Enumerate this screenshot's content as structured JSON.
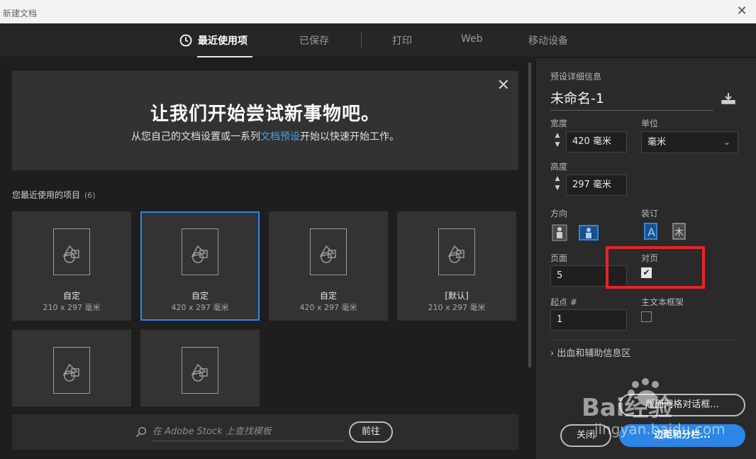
{
  "window": {
    "title": "新建文档"
  },
  "tabs": [
    {
      "label": "最近使用项",
      "active": true
    },
    {
      "label": "已保存"
    },
    {
      "label": "打印"
    },
    {
      "label": "Web"
    },
    {
      "label": "移动设备"
    }
  ],
  "welcome": {
    "heading": "让我们开始尝试新事物吧。",
    "text_before": "从您自己的文档设置或一系列",
    "link": "文档预设",
    "text_after": "开始以快速开始工作。"
  },
  "recent": {
    "label": "您最近使用的项目",
    "count": "(6)",
    "items": [
      {
        "name": "自定",
        "size": "210 x 297 毫米"
      },
      {
        "name": "自定",
        "size": "420 x 297 毫米",
        "selected": true
      },
      {
        "name": "自定",
        "size": "420 x 297 毫米"
      },
      {
        "name": "[默认]",
        "size": "210 x 297 毫米"
      },
      {
        "name": "",
        "size": ""
      },
      {
        "name": "",
        "size": ""
      }
    ]
  },
  "search": {
    "placeholder": "在 Adobe Stock 上查找模板",
    "go_label": "前往"
  },
  "details": {
    "section_title": "预设详细信息",
    "doc_name": "未命名-1",
    "width_label": "宽度",
    "width_value": "420 毫米",
    "unit_label": "单位",
    "unit_value": "毫米",
    "height_label": "高度",
    "height_value": "297 毫米",
    "orientation_label": "方向",
    "binding_label": "装订",
    "pages_label": "页面",
    "pages_value": "5",
    "facing_label": "对页",
    "facing_checked": true,
    "start_label": "起点 #",
    "start_value": "1",
    "primary_frame_label": "主文本框架",
    "primary_frame_checked": false,
    "bleed_label": "出血和辅助信息区"
  },
  "buttons": {
    "margins": "边距和分栏...",
    "close": "关闭",
    "layout_grid": "版面网格对话框..."
  },
  "colors": {
    "accent": "#2d86e6",
    "highlight": "#e5242a"
  },
  "watermark": {
    "brand": "Bai经验",
    "site": "jingyan.baidu.com"
  }
}
